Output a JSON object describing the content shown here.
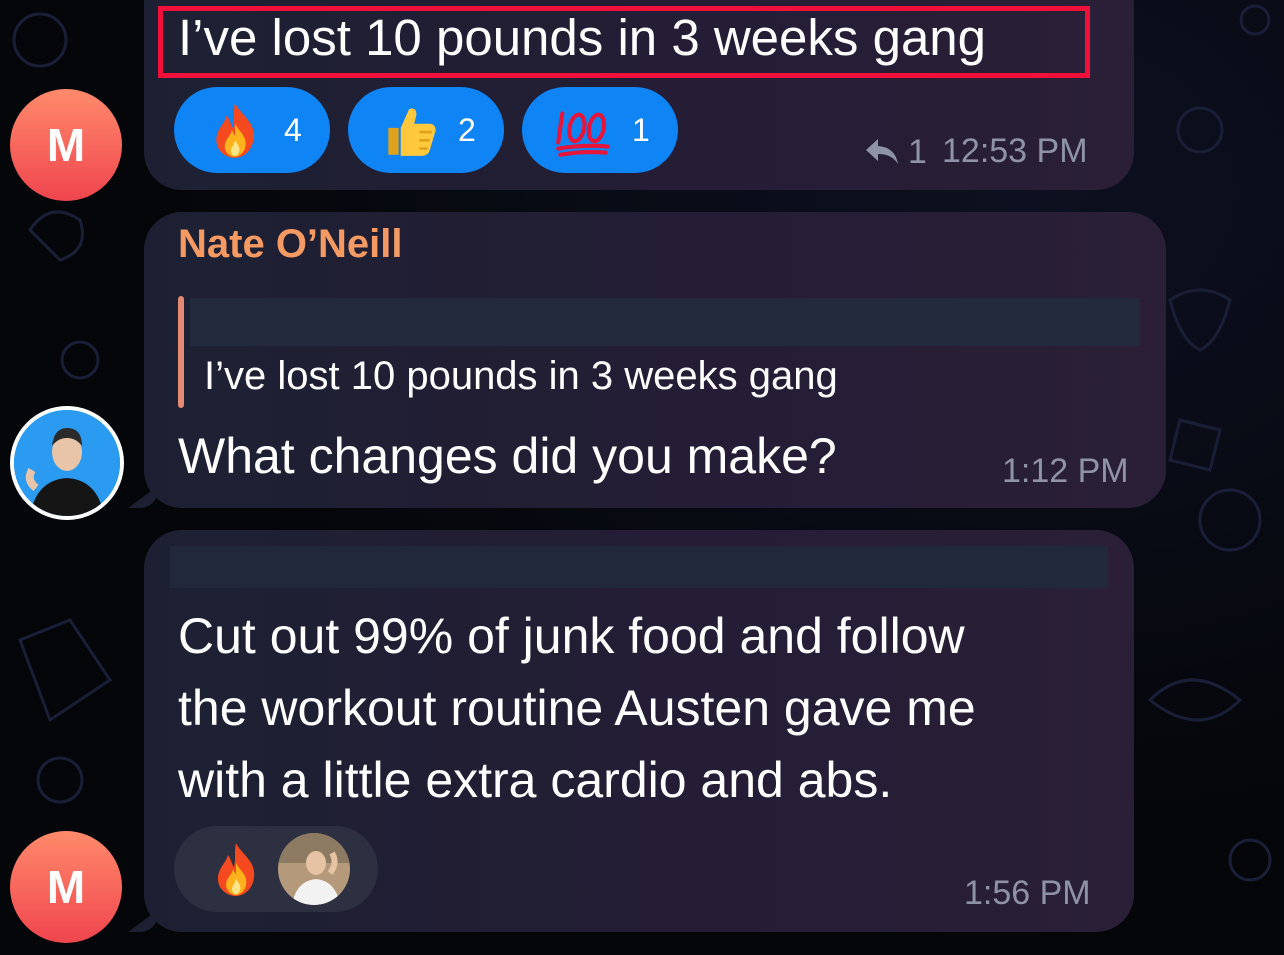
{
  "messages": [
    {
      "avatar_initial": "M",
      "text": "I’ve lost 10 pounds in 3 weeks gang",
      "reactions": [
        {
          "emoji": "fire-emoji",
          "count": "4"
        },
        {
          "emoji": "thumbs-up-emoji",
          "count": "2"
        },
        {
          "emoji": "hundred-points-emoji",
          "count": "1"
        }
      ],
      "replies": "1",
      "time": "12:53 PM"
    },
    {
      "sender": "Nate O’Neill",
      "quote": "I’ve lost 10 pounds in 3 weeks gang",
      "text": "What changes did you make?",
      "time": "1:12 PM"
    },
    {
      "avatar_initial": "M",
      "lines": [
        "Cut out 99% of junk food and follow",
        "the workout routine Austen gave me",
        "with a little extra cardio and abs."
      ],
      "reaction_emoji": "fire-emoji",
      "time": "1:56 PM"
    }
  ],
  "colors": {
    "accent": "#0f84f5",
    "sender_name": "#f59a62",
    "highlight": "#f0103a",
    "quote_bar": "#e58a72"
  }
}
